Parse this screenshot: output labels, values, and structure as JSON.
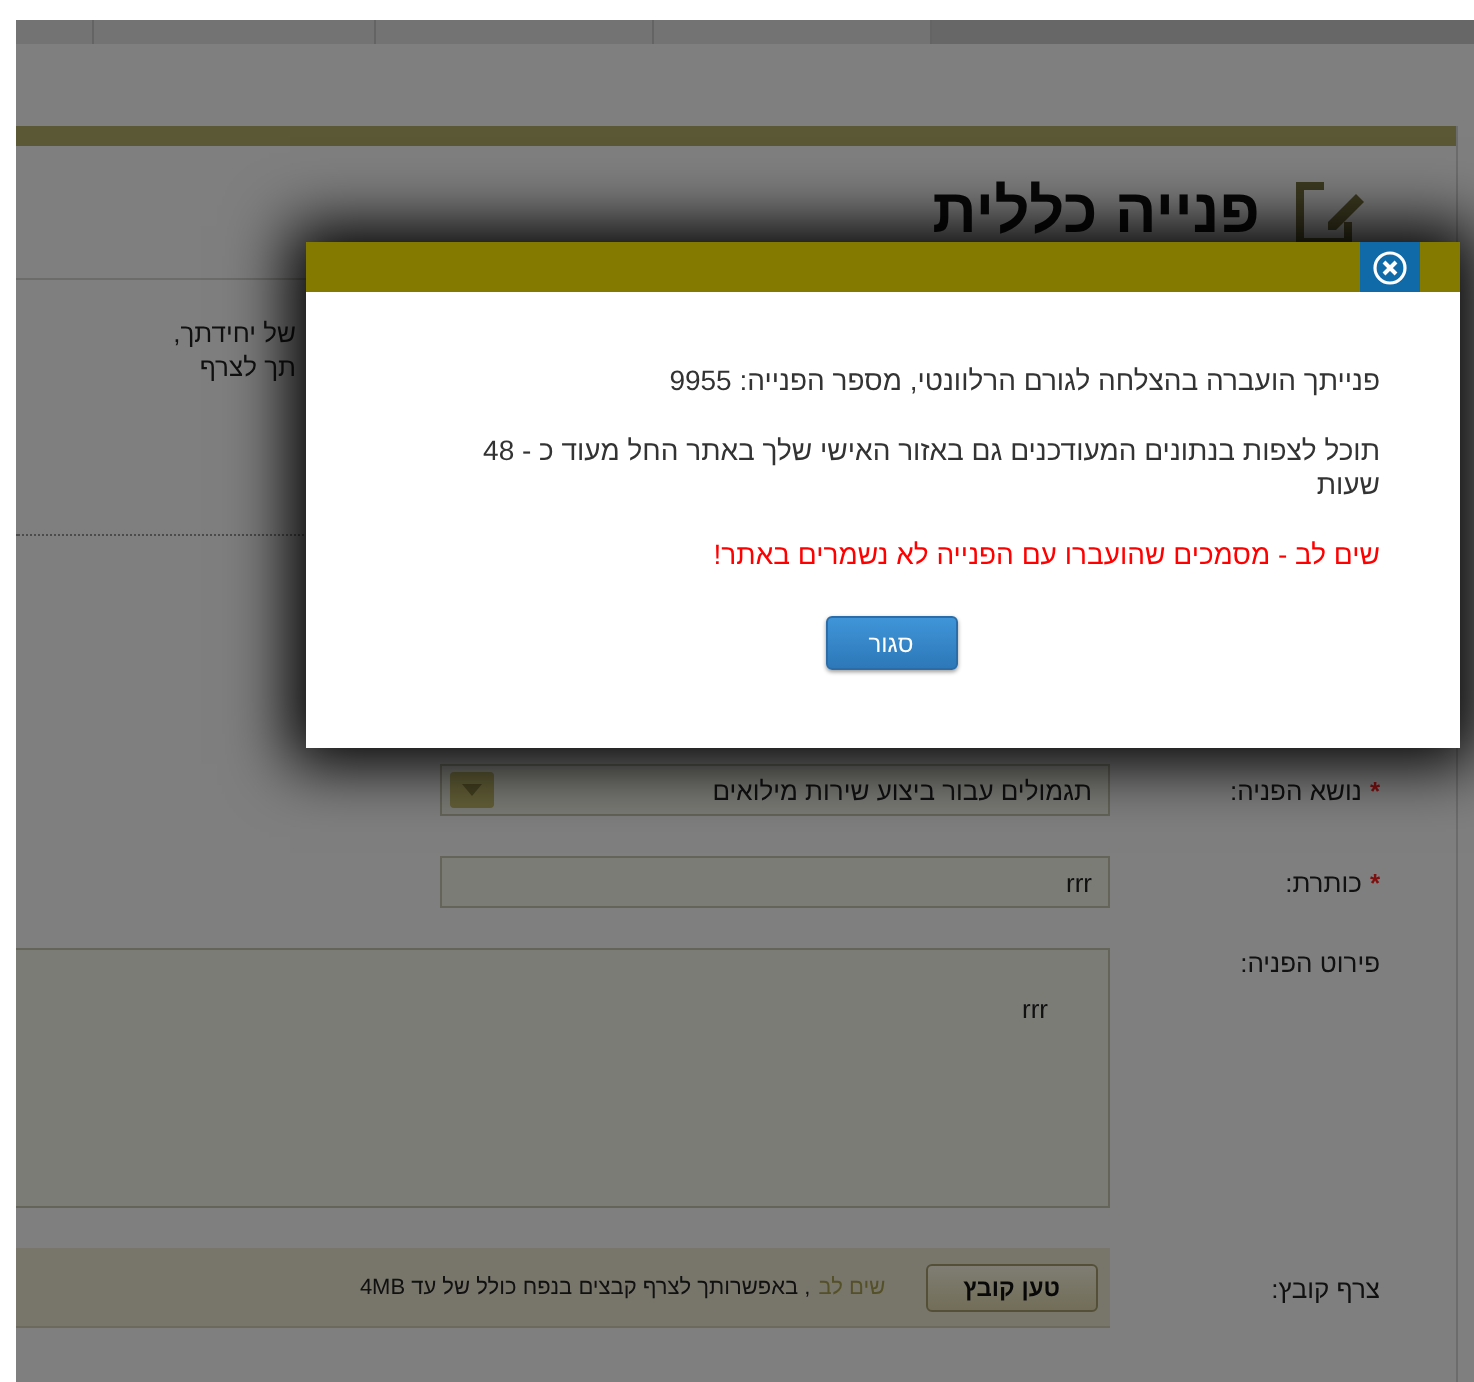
{
  "page": {
    "title": "פנייה כללית",
    "intro_lines": [
      "של יחידתך,",
      "תך לצרף"
    ],
    "form": [
      {
        "kind": "select",
        "marker": "*",
        "label": "נושא הפניה:",
        "value": "תגמולים עבור ביצוע שירות מילואים"
      },
      {
        "kind": "text",
        "marker": "*",
        "label": "כותרת:",
        "value": "rrr"
      },
      {
        "kind": "textarea",
        "label": "פירוט הפניה:",
        "value": "rrr"
      },
      {
        "kind": "file",
        "label": "צרף קובץ:",
        "button": "טען קובץ",
        "note_label": "שים לב",
        "note": ", באפשרותך לצרף קבצים בנפח כולל של עד 4MB"
      }
    ]
  },
  "modal": {
    "lines": [
      {
        "kind": "info",
        "text": "פנייתך הועברה בהצלחה לגורם הרלוונטי, מספר הפנייה: 9955"
      },
      {
        "kind": "info",
        "text": "תוכל לצפות בנתונים המעודכנים גם באזור האישי שלך באתר החל מעוד כ - 48 שעות"
      },
      {
        "kind": "warning",
        "text": "שים לב - מסמכים שהועברו עם הפנייה לא נשמרים באתר!"
      }
    ],
    "close_button": "סגור"
  }
}
